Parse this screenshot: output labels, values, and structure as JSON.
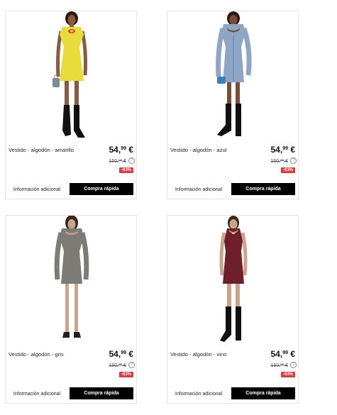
{
  "products": [
    {
      "name": "Vestido - algodón - amarillo",
      "price_int": "54,",
      "price_dec": "99",
      "price_cur": " €",
      "old_int": "150,",
      "old_dec": "00",
      "old_cur": " €",
      "discount": "-63%",
      "info_label": "Información adicional",
      "quick_label": "Compra rápida",
      "info_icon": "?",
      "dress_color": "#e8dc3a",
      "accent": "#d23a3a",
      "bag_color": "#7c8a99"
    },
    {
      "name": "Vestido - algodón - azul",
      "price_int": "54,",
      "price_dec": "99",
      "price_cur": " €",
      "old_int": "150,",
      "old_dec": "00",
      "old_cur": " €",
      "discount": "-63%",
      "info_label": "Información adicional",
      "quick_label": "Compra rápida",
      "info_icon": "?",
      "dress_color": "#8ea6c6",
      "accent": "#6b84a8",
      "bag_color": "#3a7fc4"
    },
    {
      "name": "Vestido - algodón - gris",
      "price_int": "54,",
      "price_dec": "99",
      "price_cur": " €",
      "old_int": "150,",
      "old_dec": "00",
      "old_cur": " €",
      "discount": "-63%",
      "info_label": "Información adicional",
      "quick_label": "Compra rápida",
      "info_icon": "?",
      "dress_color": "#7d7b76",
      "accent": "#5d5b57",
      "bag_color": "none"
    },
    {
      "name": "Vestido - algodón - vino",
      "price_int": "54,",
      "price_dec": "99",
      "price_cur": " €",
      "old_int": "150,",
      "old_dec": "00",
      "old_cur": " €",
      "discount": "-63%",
      "info_label": "Información adicional",
      "quick_label": "Compra rápida",
      "info_icon": "?",
      "dress_color": "#6e1f2a",
      "accent": "#4d1019",
      "bag_color": "none"
    }
  ]
}
